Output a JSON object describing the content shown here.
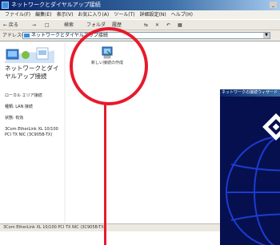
{
  "window": {
    "title": "ネットワークとダイヤルアップ接続",
    "minimize_label": "_"
  },
  "menu": [
    "ファイル(F)",
    "編集(E)",
    "表示(V)",
    "お気に入り(A)",
    "ツール(T)",
    "詳細設定(N)",
    "ヘルプ(H)"
  ],
  "toolbar": {
    "back": "← 戻る",
    "forward": "→",
    "up": "□",
    "search": "検索",
    "folders": "フォルダ",
    "history": "履歴"
  },
  "address": {
    "label": "アドレス(D)",
    "value": "ネットワークとダイヤルアップ接続"
  },
  "left_pane": {
    "title": "ネットワークとダイヤルアップ接続",
    "props": [
      "ローカル エリア接続",
      "種類: LAN 接続",
      "状態: 有効",
      "3Com EtherLink XL 10/100 PCI TX NIC (3C905B-TX)"
    ]
  },
  "item": {
    "label": "新しい接続の作成"
  },
  "status": {
    "text": "3Com EtherLink XL 10/100 PCI TX NIC (3C905B-TX)"
  },
  "dialog": {
    "title": "ネットワークの接続ウィザード"
  },
  "colors": {
    "callout": "#e8192c",
    "titlebar": "#0a246a"
  }
}
